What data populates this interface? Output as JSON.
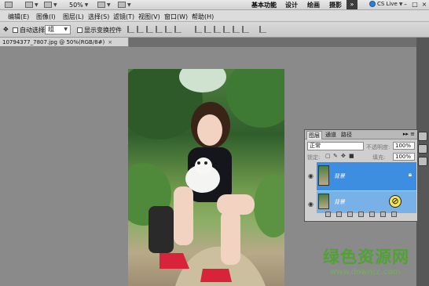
{
  "appbar": {
    "zoom": "50%",
    "workspaces": [
      "基本功能",
      "设计",
      "绘画",
      "摄影"
    ],
    "expand": "»",
    "cslive": "CS Live",
    "window_controls": [
      "–",
      "□",
      "×"
    ]
  },
  "menubar": {
    "items": [
      "编辑(E)",
      "图像(I)",
      "图层(L)",
      "选择(S)",
      "滤镜(T)",
      "视图(V)",
      "窗口(W)",
      "帮助(H)"
    ]
  },
  "options": {
    "auto_select_label": "自动选择:",
    "auto_select_value": "组",
    "show_transform_label": "显示变换控件"
  },
  "document": {
    "tab_title": "10794377_7807.jpg @ 50%(RGB/8#)",
    "close": "×"
  },
  "layers_panel": {
    "tabs": [
      "图层",
      "通道",
      "路径"
    ],
    "menu_icon": "▸▸ ≡",
    "blend_mode": "正常",
    "opacity_label": "不透明度:",
    "opacity_value": "100%",
    "fill_label": "填充:",
    "fill_value": "100%",
    "lock_label": "锁定:",
    "layers": [
      {
        "name": "背景",
        "selected": true,
        "color": "#3d8ee0"
      },
      {
        "name": "背景",
        "selected": false,
        "color": "#78b0e8"
      }
    ]
  },
  "watermark": {
    "brand": "绿色资源网",
    "url": "www.downcc.com"
  },
  "icons": {
    "move_tool": "move-tool-icon",
    "eye": "eye-icon",
    "lock": "lock-icon",
    "no_sign": "no-sign-icon"
  }
}
